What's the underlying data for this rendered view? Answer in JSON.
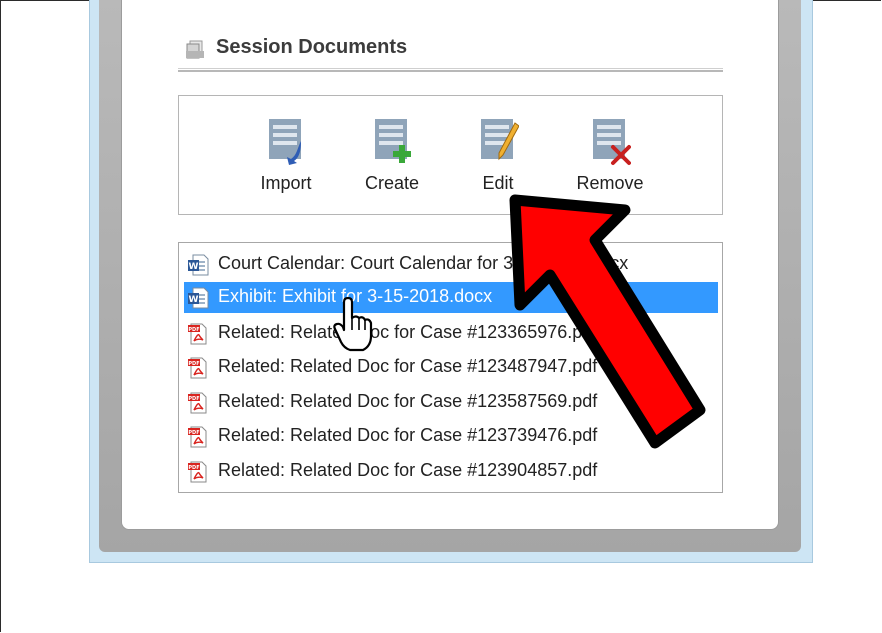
{
  "section": {
    "title": "Session Documents"
  },
  "toolbar": {
    "import_label": "Import",
    "create_label": "Create",
    "edit_label": "Edit",
    "remove_label": "Remove"
  },
  "documents": [
    {
      "label": "Court Calendar: Court Calendar for 3-15-2018.docx",
      "type": "word",
      "selected": false
    },
    {
      "label": "Exhibit: Exhibit for 3-15-2018.docx",
      "type": "word",
      "selected": true
    },
    {
      "label": "Related: Related Doc for Case #123365976.pdf",
      "type": "pdf",
      "selected": false
    },
    {
      "label": "Related: Related Doc for Case #123487947.pdf",
      "type": "pdf",
      "selected": false
    },
    {
      "label": "Related: Related Doc for Case #123587569.pdf",
      "type": "pdf",
      "selected": false
    },
    {
      "label": "Related: Related Doc for Case #123739476.pdf",
      "type": "pdf",
      "selected": false
    },
    {
      "label": "Related: Related Doc for Case #123904857.pdf",
      "type": "pdf",
      "selected": false
    }
  ],
  "colors": {
    "selection": "#3399ff",
    "arrow": "#ff0000",
    "arrow_outline": "#000000"
  }
}
